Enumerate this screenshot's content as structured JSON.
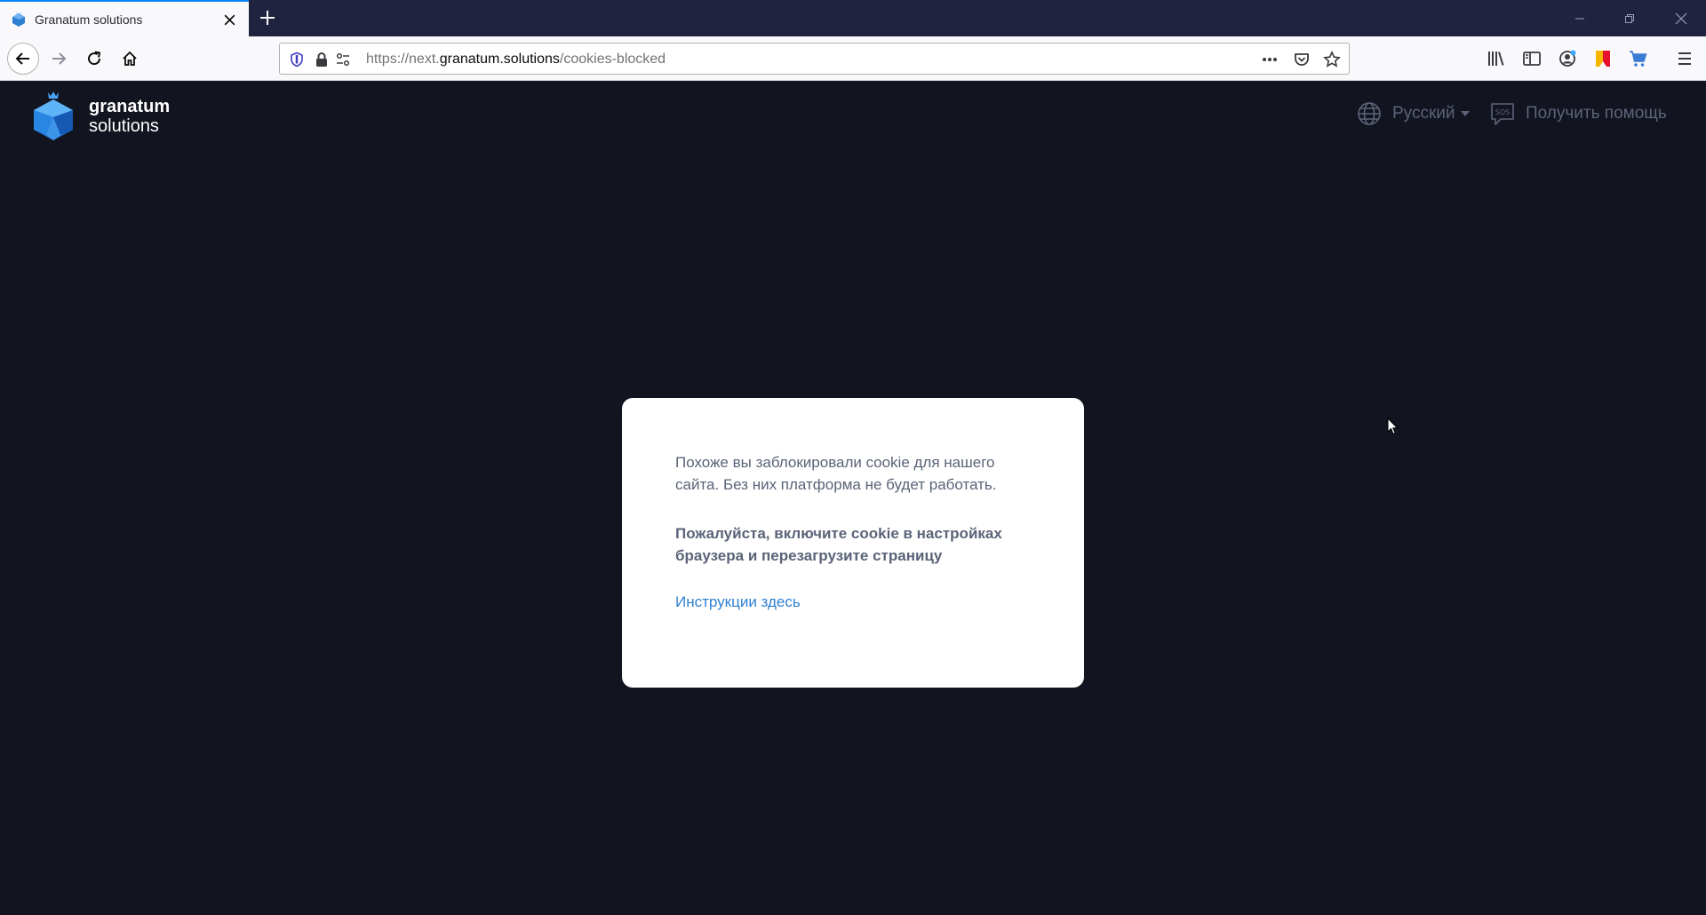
{
  "browser": {
    "tab": {
      "title": "Granatum solutions",
      "favicon": "granatum-favicon-icon"
    },
    "url": {
      "prefix": "https://next.",
      "host": "granatum.solutions",
      "path": "/cookies-blocked"
    },
    "colors": {
      "tabbar": "#202340",
      "accent": "#0a84ff"
    }
  },
  "page": {
    "logo": {
      "line1": "granatum",
      "line2": "solutions"
    },
    "header": {
      "language": "Русский",
      "help": "Получить помощь"
    },
    "modal": {
      "message": "Похоже вы заблокировали cookie для нашего сайта. Без них платформа не будет работать.",
      "instruction": "Пожалуйста, включите cookie в настройках браузера и перезагрузите страницу",
      "link": "Инструкции здесь"
    },
    "colors": {
      "background": "#12141f",
      "muted": "#5c6478",
      "link": "#2f7fd1",
      "text": "#5a6378"
    }
  }
}
